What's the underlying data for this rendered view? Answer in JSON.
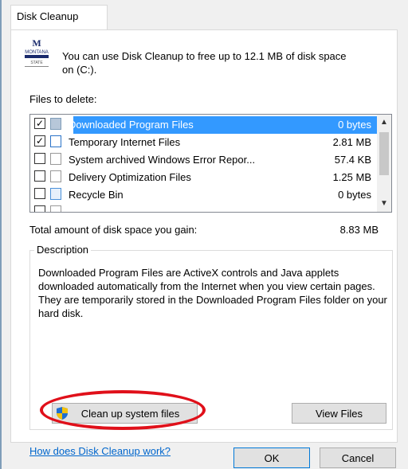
{
  "tab": {
    "label": "Disk Cleanup"
  },
  "logo": {
    "line1": "M",
    "line2": "MONTANA",
    "line3": "STATE"
  },
  "intro": {
    "text": "You can use Disk Cleanup to free up to 12.1 MB of disk space on  (C:)."
  },
  "files_label": "Files to delete:",
  "files": [
    {
      "name": "Downloaded Program Files",
      "size": "0 bytes",
      "checked": true,
      "selected": true
    },
    {
      "name": "Temporary Internet Files",
      "size": "2.81 MB",
      "checked": true,
      "selected": false
    },
    {
      "name": "System archived Windows Error Repor...",
      "size": "57.4 KB",
      "checked": false,
      "selected": false
    },
    {
      "name": "Delivery Optimization Files",
      "size": "1.25 MB",
      "checked": false,
      "selected": false
    },
    {
      "name": "Recycle Bin",
      "size": "0 bytes",
      "checked": false,
      "selected": false
    }
  ],
  "total": {
    "label": "Total amount of disk space you gain:",
    "value": "8.83 MB"
  },
  "description": {
    "title": "Description",
    "text": "Downloaded Program Files are ActiveX controls and Java applets downloaded automatically from the Internet when you view certain pages. They are temporarily stored in the Downloaded Program Files folder on your hard disk."
  },
  "buttons": {
    "cleanup": "Clean up system files",
    "view_files": "View Files",
    "ok": "OK",
    "cancel": "Cancel"
  },
  "help_link": "How does Disk Cleanup work?",
  "colors": {
    "selection": "#3399ff",
    "highlight": "#e0101a",
    "link": "#0066cc"
  }
}
